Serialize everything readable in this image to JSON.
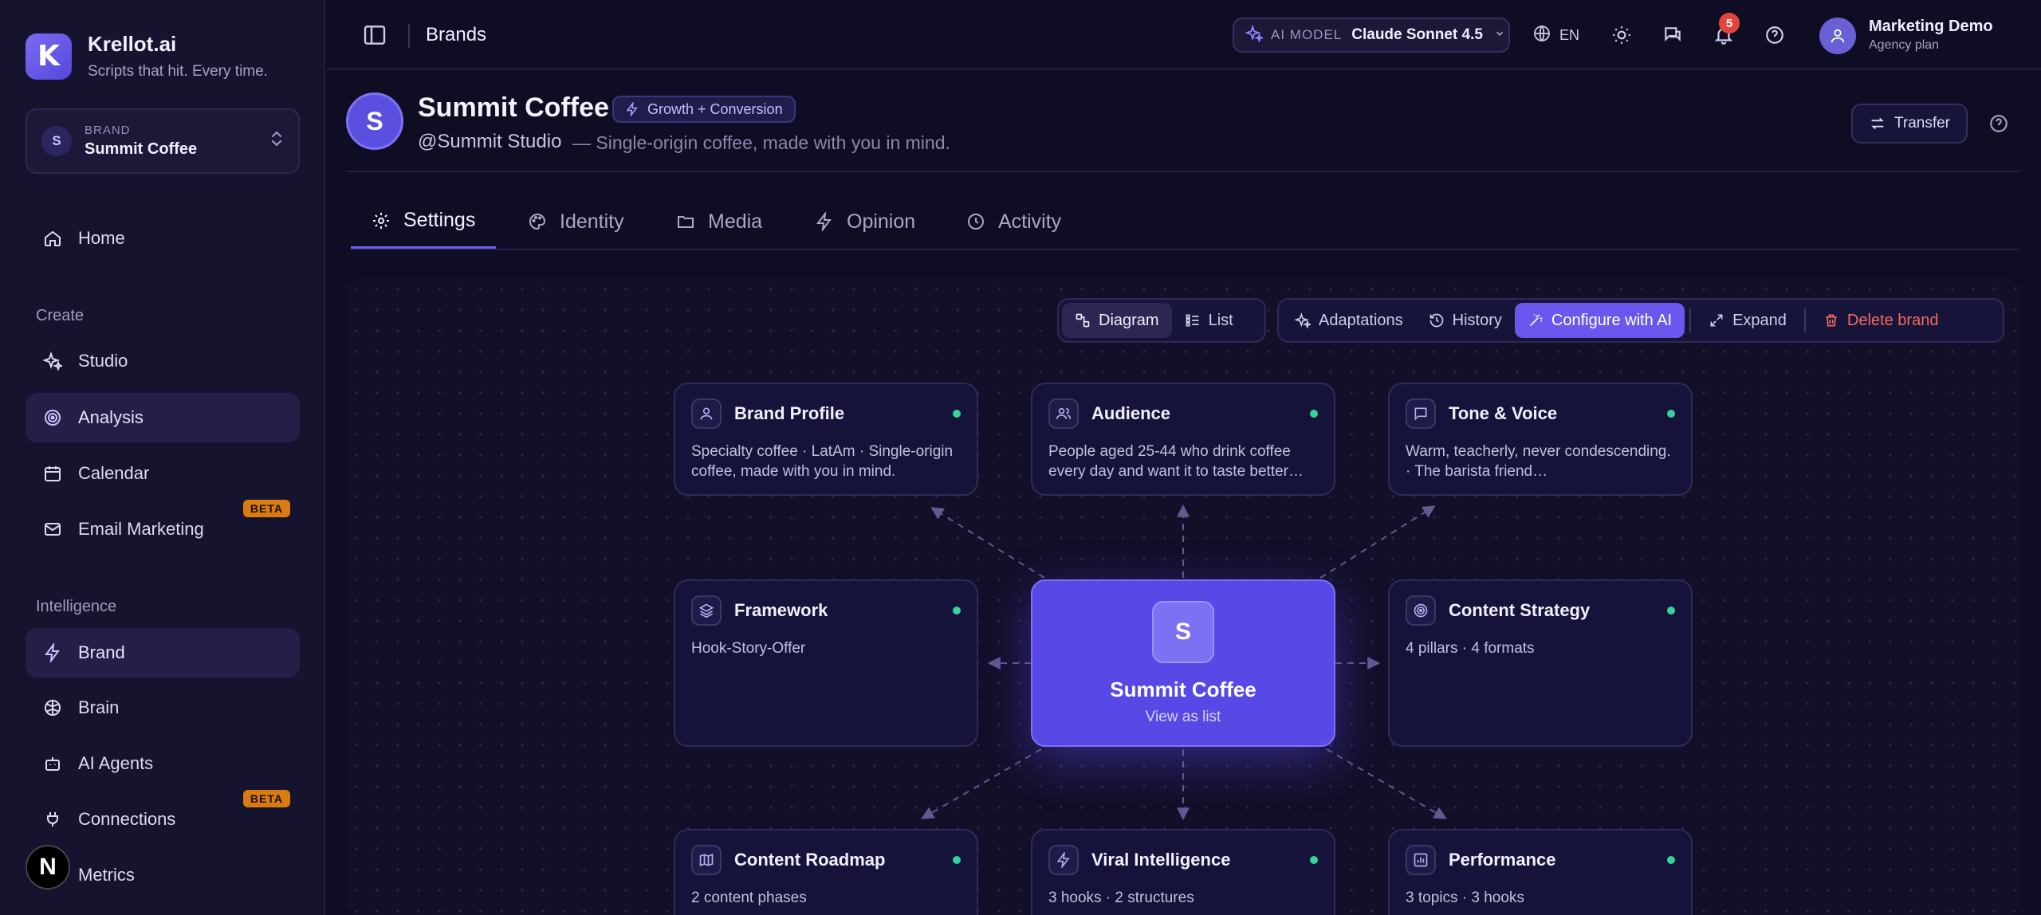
{
  "app": {
    "name": "Krellot.ai",
    "tagline": "Scripts that hit. Every time."
  },
  "brand_selector": {
    "caption": "BRAND",
    "initial": "S",
    "name": "Summit Coffee"
  },
  "sidebar": {
    "items": [
      {
        "label": "Home",
        "icon": "home-icon"
      },
      {
        "label": "Studio",
        "icon": "sparkle-icon"
      },
      {
        "label": "Analysis",
        "icon": "radar-icon"
      },
      {
        "label": "Calendar",
        "icon": "calendar-icon"
      },
      {
        "label": "Email Marketing",
        "icon": "mail-icon",
        "badge": "BETA"
      },
      {
        "label": "Brand",
        "icon": "bolt-icon"
      },
      {
        "label": "Brain",
        "icon": "brain-icon"
      },
      {
        "label": "AI Agents",
        "icon": "bot-icon"
      },
      {
        "label": "Connections",
        "icon": "plug-icon",
        "badge": "BETA"
      },
      {
        "label": "Metrics",
        "icon": "chart-icon"
      }
    ],
    "sections": {
      "create": "Create",
      "intelligence": "Intelligence"
    },
    "bottom_badge": "N"
  },
  "topbar": {
    "page": "Brands",
    "model_caption": "AI MODEL",
    "model_name": "Claude Sonnet 4.5",
    "language": "EN",
    "notifications": "5",
    "user_name": "Marketing Demo",
    "user_plan": "Agency plan"
  },
  "brand": {
    "initial": "S",
    "name": "Summit Coffee",
    "tag": "Growth + Conversion",
    "handle": "@Summit Studio",
    "description": "— Single-origin coffee, made with you in mind.",
    "transfer_label": "Transfer"
  },
  "tabs": [
    {
      "label": "Settings",
      "icon": "gear-icon",
      "active": true
    },
    {
      "label": "Identity",
      "icon": "palette-icon"
    },
    {
      "label": "Media",
      "icon": "folder-icon"
    },
    {
      "label": "Opinion",
      "icon": "bolt-icon"
    },
    {
      "label": "Activity",
      "icon": "clock-icon"
    }
  ],
  "view_toggle": {
    "diagram": "Diagram",
    "list": "List"
  },
  "actions": {
    "adaptations": "Adaptations",
    "history": "History",
    "configure": "Configure with AI",
    "expand": "Expand",
    "delete": "Delete brand"
  },
  "center_node": {
    "initial": "S",
    "title": "Summit Coffee",
    "subtitle": "View as list"
  },
  "nodes": [
    {
      "title": "Brand Profile",
      "icon": "user-icon",
      "desc": "Specialty coffee · LatAm · Single-origin coffee, made with you in mind."
    },
    {
      "title": "Audience",
      "icon": "users-icon",
      "desc": "People aged 25-44 who drink coffee every day and want it to taste better…"
    },
    {
      "title": "Tone & Voice",
      "icon": "message-icon",
      "desc": "Warm, teacherly, never condescending. · The barista friend…"
    },
    {
      "title": "Framework",
      "icon": "layers-icon",
      "desc": "Hook-Story-Offer"
    },
    {
      "title": "Content Strategy",
      "icon": "target-icon",
      "desc": "4 pillars · 4 formats"
    },
    {
      "title": "Content Roadmap",
      "icon": "map-icon",
      "desc": "2 content phases"
    },
    {
      "title": "Viral Intelligence",
      "icon": "zap-icon",
      "desc": "3 hooks · 2 structures"
    },
    {
      "title": "Performance",
      "icon": "chart-icon",
      "desc": "3 topics · 3 hooks"
    }
  ],
  "colors": {
    "accent": "#5848e6",
    "status_ok": "#34d399",
    "danger": "#f26a62",
    "beta": "#d97b10"
  }
}
